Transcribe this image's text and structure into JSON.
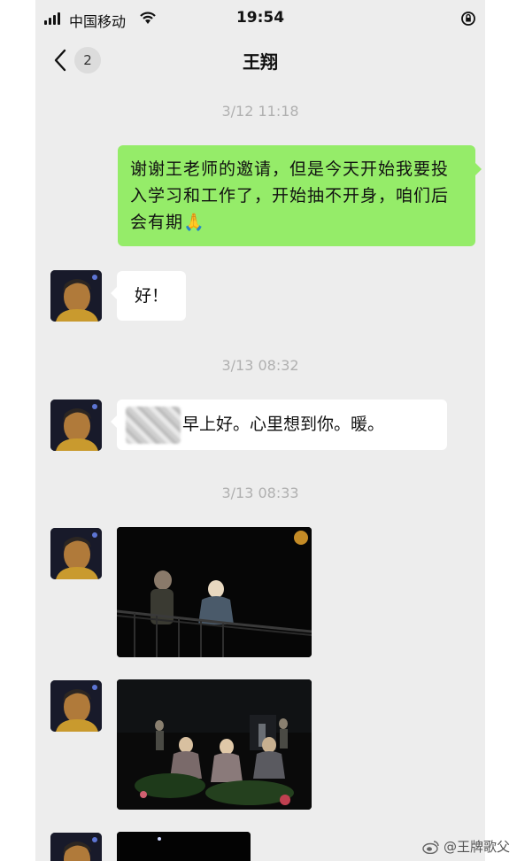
{
  "status_bar": {
    "carrier": "中国移动",
    "time": "19:54"
  },
  "nav": {
    "title": "王翔",
    "unread_count": "2"
  },
  "messages": [
    {
      "type": "timestamp",
      "text": "3/12 11:18"
    },
    {
      "type": "text",
      "sender": "self",
      "text": "谢谢王老师的邀请，但是今天开始我要投入学习和工作了，开始抽不开身，咱们后会有期",
      "emoji": "🙏"
    },
    {
      "type": "text",
      "sender": "other",
      "text": "好！"
    },
    {
      "type": "timestamp",
      "text": "3/13 08:32"
    },
    {
      "type": "text",
      "sender": "other",
      "text": "早上好。心里想到你。暖。",
      "obscured_prefix": true
    },
    {
      "type": "timestamp",
      "text": "3/13 08:33"
    },
    {
      "type": "image",
      "sender": "other",
      "subject": "stage photo"
    },
    {
      "type": "image",
      "sender": "other",
      "subject": "stage photo"
    },
    {
      "type": "image",
      "sender": "other",
      "subject": "stage photo"
    }
  ],
  "watermark": {
    "text": "@王牌歌父",
    "icon": "weibo-icon"
  },
  "icons": [
    "signal-icon",
    "wifi-icon",
    "screen-lock-icon",
    "back-chevron-icon"
  ],
  "colors": {
    "chat_background": "#ededed",
    "self_bubble": "#95ec69",
    "other_bubble": "#ffffff",
    "timestamp": "#b0b0b0"
  }
}
